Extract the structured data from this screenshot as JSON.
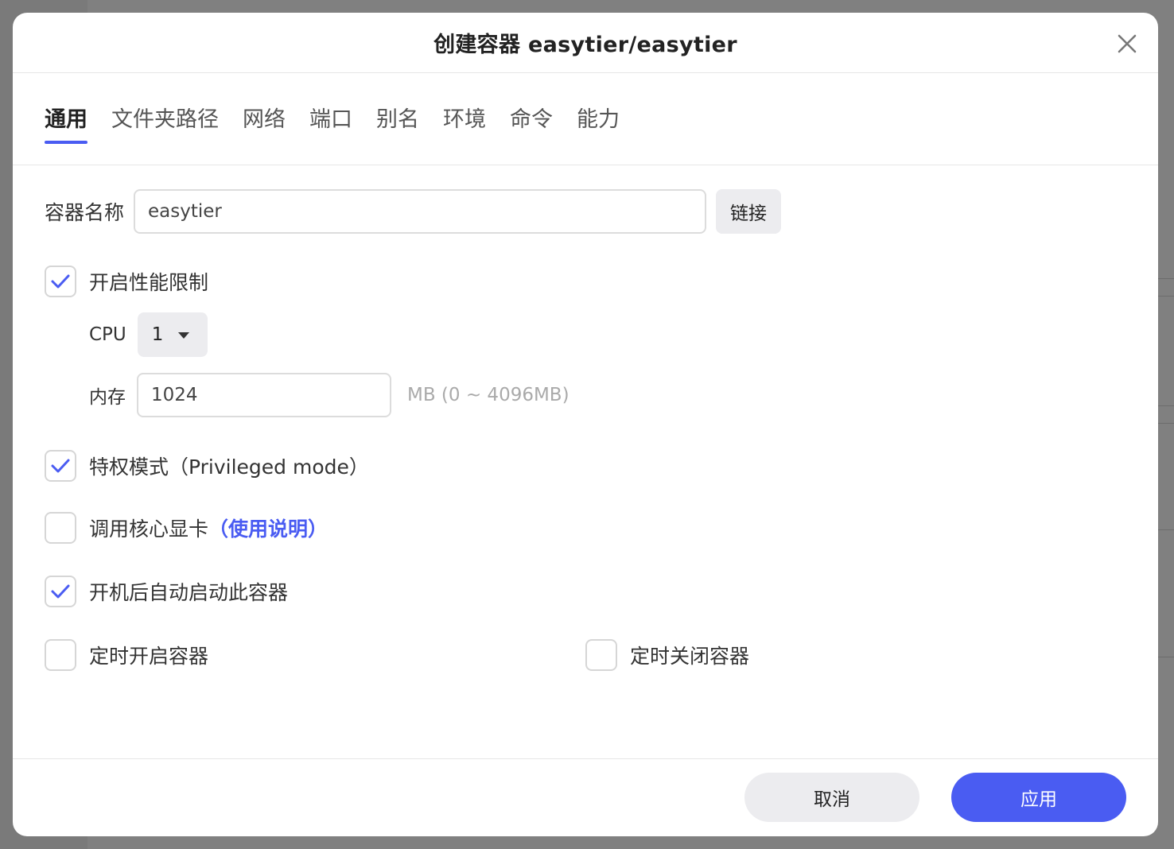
{
  "dialog": {
    "title": "创建容器 easytier/easytier"
  },
  "tabs": [
    {
      "label": "通用",
      "active": true
    },
    {
      "label": "文件夹路径",
      "active": false
    },
    {
      "label": "网络",
      "active": false
    },
    {
      "label": "端口",
      "active": false
    },
    {
      "label": "别名",
      "active": false
    },
    {
      "label": "环境",
      "active": false
    },
    {
      "label": "命令",
      "active": false
    },
    {
      "label": "能力",
      "active": false
    }
  ],
  "general": {
    "container_name_label": "容器名称",
    "container_name_value": "easytier",
    "link_button": "链接",
    "perf_limit": {
      "label": "开启性能限制",
      "checked": true
    },
    "cpu": {
      "label": "CPU",
      "value": "1"
    },
    "memory": {
      "label": "内存",
      "value": "1024",
      "hint": "MB (0 ~ 4096MB)"
    },
    "privileged": {
      "label": "特权模式（Privileged mode）",
      "checked": true
    },
    "gpu": {
      "label": "调用核心显卡",
      "link": "（使用说明）",
      "checked": false
    },
    "autostart": {
      "label": "开机后自动启动此容器",
      "checked": true
    },
    "schedule_start": {
      "label": "定时开启容器",
      "checked": false
    },
    "schedule_stop": {
      "label": "定时关闭容器",
      "checked": false
    }
  },
  "footer": {
    "cancel": "取消",
    "apply": "应用"
  },
  "colors": {
    "accent": "#4a5cf2",
    "overlay": "#808080"
  },
  "icons": {
    "close": "close-icon",
    "check": "checkmark-icon",
    "dropdown": "caret-down-icon"
  }
}
